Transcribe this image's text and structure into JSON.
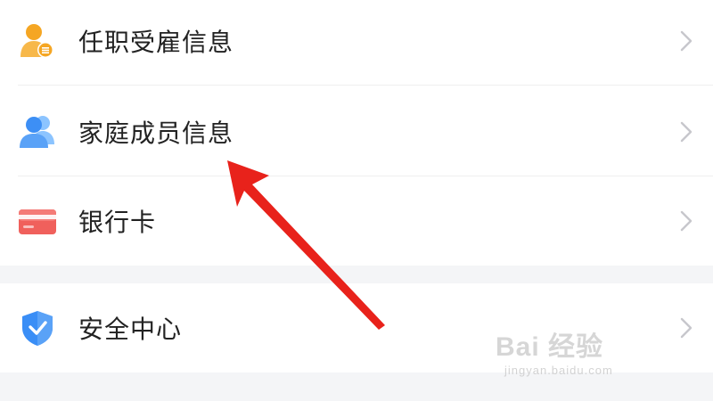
{
  "menu": {
    "items": [
      {
        "label": "任职受雇信息",
        "icon": "employment-info-icon"
      },
      {
        "label": "家庭成员信息",
        "icon": "family-members-icon"
      },
      {
        "label": "银行卡",
        "icon": "bank-card-icon"
      },
      {
        "label": "安全中心",
        "icon": "shield-icon"
      }
    ]
  },
  "watermark": {
    "logo": "Bai 经验",
    "url": "jingyan.baidu.com"
  },
  "colors": {
    "background": "#f4f5f7",
    "employment_icon": "#f5a623",
    "family_icon": "#3d8ff5",
    "bank_icon": "#f0605c",
    "shield_icon": "#3a8ef6",
    "annotation_arrow": "#e8221b"
  }
}
